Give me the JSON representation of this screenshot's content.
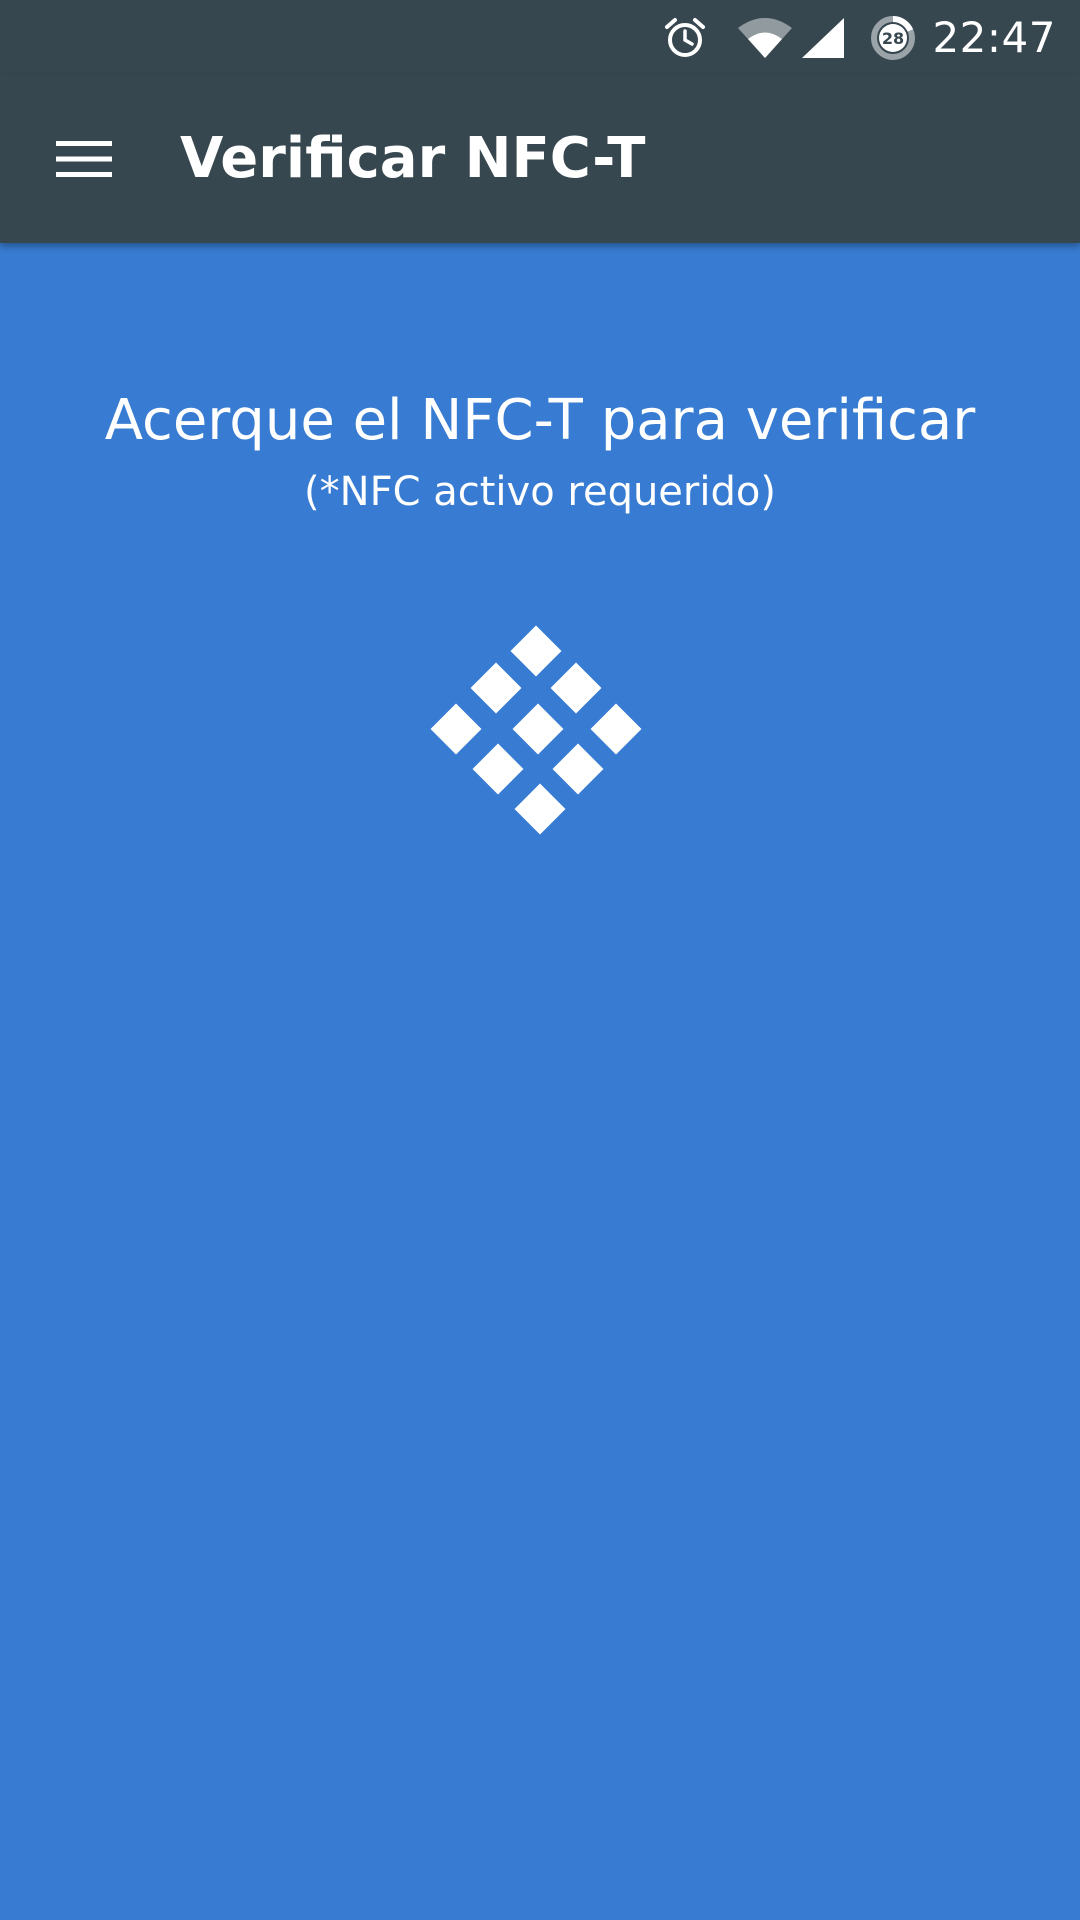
{
  "status_bar": {
    "time": "22:47",
    "battery_level": "28",
    "icons": [
      "alarm-icon",
      "wifi-icon",
      "signal-icon",
      "battery-icon"
    ]
  },
  "app_bar": {
    "title": "Verificar NFC-T",
    "menu_icon": "hamburger-menu-icon"
  },
  "main": {
    "instruction": "Acerque el NFC-T para verificar",
    "note": "(*NFC activo requerido)",
    "graphic_icon": "nfc-diamond-grid-icon"
  },
  "colors": {
    "app_bar": "#37474f",
    "background": "#377cd2",
    "text": "#ffffff"
  }
}
